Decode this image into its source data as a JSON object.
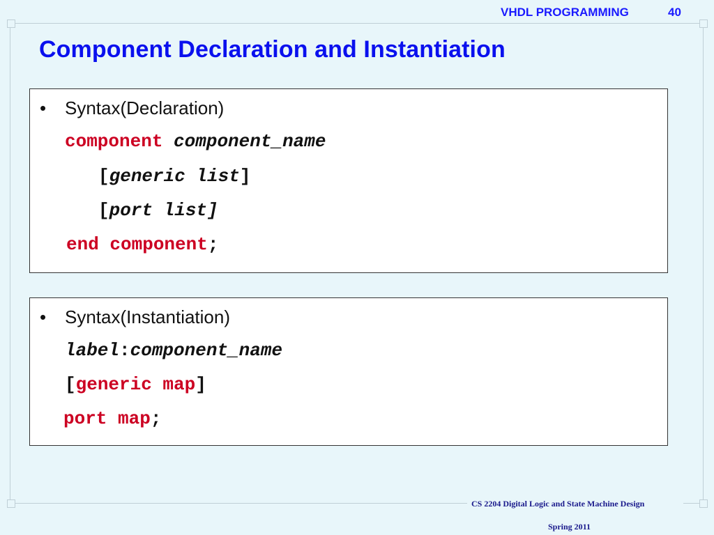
{
  "header": {
    "course_title": "VHDL PROGRAMMING",
    "page_number": "40"
  },
  "slide": {
    "title": "Component Declaration and Instantiation"
  },
  "declaration": {
    "bullet": "•",
    "heading": "Syntax(Declaration)",
    "kw_component": "component",
    "component_name": "component_name",
    "open_bracket": "[",
    "close_bracket": "]",
    "generic_list": "generic list",
    "port_list": "port list]",
    "kw_end_component": "end component",
    "semicolon": ";"
  },
  "instantiation": {
    "bullet": "•",
    "heading": "Syntax(Instantiation)",
    "label": "label",
    "colon": ":",
    "component_name": "component_name",
    "open_bracket": "[",
    "close_bracket": "]",
    "kw_generic_map": "generic map",
    "kw_port_map": "port map",
    "semicolon": ";"
  },
  "footer": {
    "course_line": "CS 2204 Digital Logic and State Machine Design",
    "term": "Spring 2011"
  }
}
